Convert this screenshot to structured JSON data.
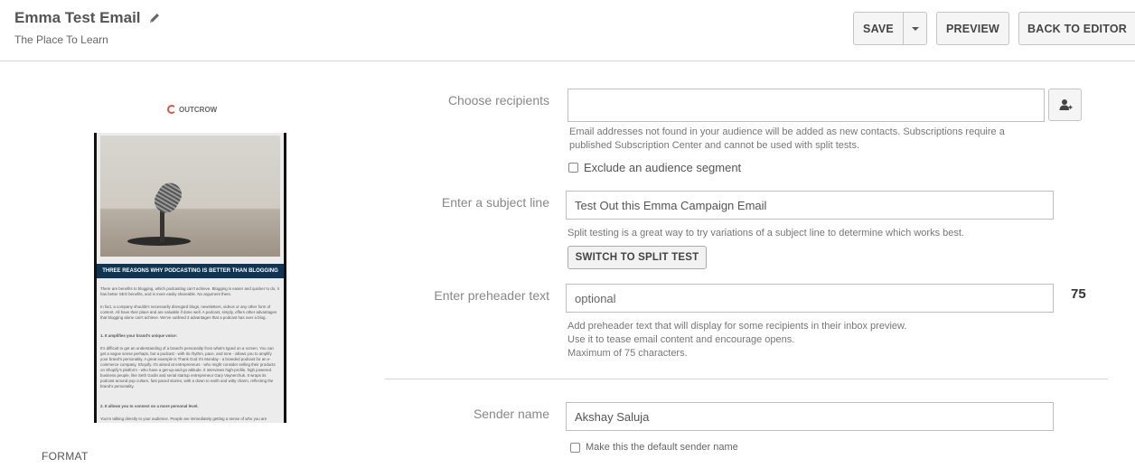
{
  "header": {
    "title": "Emma Test Email",
    "subtitle": "The Place To Learn",
    "save_label": "SAVE",
    "preview_label": "PREVIEW",
    "back_label": "BACK TO EDITOR"
  },
  "preview": {
    "logo_text": "OUTCROW",
    "headline": "THREE REASONS WHY PODCASTING IS BETTER THAN BLOGGING",
    "paragraphs": [
      "There are benefits to blogging, which podcasting can't achieve. Blogging is easier and quicker to do, it has better SEO benefits, and is more easily shareable. No argument there.",
      "In fact, a company shouldn't necessarily disregard blogs, newsletters, videos or any other form of content. All have their place and are valuable if done well. A podcast, simply, offers other advantages that blogging alone can't achieve. We've outlined 3 advantages that a podcast has over a blog.",
      "1. It amplifies your brand's unique voice:",
      "It's difficult to get an understanding of a brand's personality from what's typed on a screen. You can get a vague sense perhaps, but a podcast - with its rhythm, pace, and tone - allows you to amplify your brand's personality. A great example is Thank God It's Monday - a branded podcast for an e-commerce company, Shopify. It's aimed at entrepreneurs - who might consider selling their products on Shopify's platform - who have a get-up-and-go attitude. It interviews high-profile, high powered business people, like Seth Godin and serial startup entrepreneur Gary Vaynerchuk. It wraps its podcast around pop culture, fast paced stories, with a down to earth and witty charm, reflecting the brand's personality.",
      "2. It allows you to connect on a more personal level.",
      "You're talking directly to your audience. People are immediately getting a sense of who you are"
    ],
    "format_label": "FORMAT"
  },
  "form": {
    "recipients_label": "Choose recipients",
    "recipients_value": "",
    "recipients_help_1": "Email addresses not found in your audience will be added as new contacts. Subscriptions require a",
    "recipients_help_2": "published Subscription Center and cannot be used with split tests.",
    "exclude_label": "Exclude an audience segment",
    "subject_label": "Enter a subject line",
    "subject_value": "Test Out this Emma Campaign Email",
    "subject_help": "Split testing is a great way to try variations of a subject line to determine which works best.",
    "split_button": "SWITCH TO SPLIT TEST",
    "preheader_label": "Enter preheader text",
    "preheader_value": "optional",
    "preheader_count": "75",
    "preheader_help_1": "Add preheader text that will display for some recipients in their inbox preview.",
    "preheader_help_2": "Use it to tease email content and encourage opens.",
    "preheader_help_3": "Maximum of 75 characters.",
    "sender_label": "Sender name",
    "sender_value": "Akshay Saluja",
    "default_sender_label": "Make this the default sender name"
  },
  "icons": [
    "pencil-icon",
    "chevron-down-icon",
    "add-person-icon",
    "outcrow-logo-icon"
  ]
}
